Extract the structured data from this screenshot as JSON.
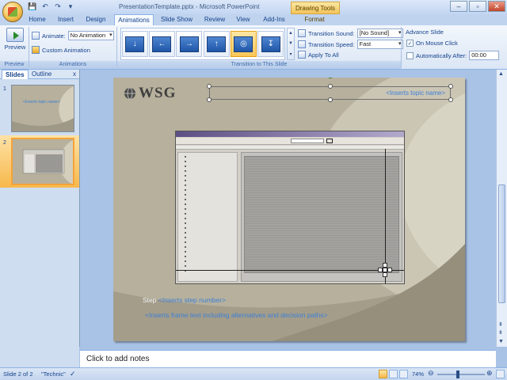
{
  "window": {
    "title": "PresentationTemplate.pptx - Microsoft PowerPoint",
    "contextual_tab": "Drawing Tools",
    "controls": [
      "–",
      "▫",
      "✕"
    ]
  },
  "quick_access": [
    "save-icon",
    "undo-icon",
    "redo-icon",
    "customize-icon"
  ],
  "tabs": [
    "Home",
    "Insert",
    "Design",
    "Animations",
    "Slide Show",
    "Review",
    "View",
    "Add-Ins",
    "Format"
  ],
  "active_tab": "Animations",
  "ribbon": {
    "preview_group": {
      "button": "Preview",
      "label": "Preview"
    },
    "animations_group": {
      "animate_label": "Animate:",
      "animate_value": "No Animation",
      "custom_animation": "Custom Animation",
      "label": "Animations"
    },
    "transition_group": {
      "transition_sound_label": "Transition Sound:",
      "transition_sound_value": "[No Sound]",
      "transition_speed_label": "Transition Speed:",
      "transition_speed_value": "Fast",
      "apply_to_all": "Apply To All",
      "label": "Transition to This Slide"
    },
    "advance_group": {
      "title": "Advance Slide",
      "on_mouse_click": "On Mouse Click",
      "on_mouse_click_checked": true,
      "automatically_after": "Automatically After:",
      "automatically_after_checked": false,
      "time_value": "00:00"
    }
  },
  "side_panel": {
    "tabs": [
      "Slides",
      "Outline"
    ],
    "close": "x",
    "thumbnails": [
      {
        "number": "1",
        "text": "<Inserts topic name>"
      },
      {
        "number": "2"
      }
    ]
  },
  "slide": {
    "logo_text": "WSG",
    "topic_placeholder": "<Inserts topic name>",
    "step_label": "Step",
    "step_placeholder": "<Inserts step number>",
    "frame_text": "<Inserts frame text including alternatives and decision paths>"
  },
  "notes_placeholder": "Click to add notes",
  "status": {
    "slide_counter": "Slide 2 of 2",
    "theme": "\"Technic\"",
    "zoom": "74%"
  },
  "colors": {
    "ribbon_bg": "#dbe6f5",
    "accent_blue": "#15428b",
    "slide_bg": "#b6b09c",
    "placeholder_text": "#3d7fd8",
    "selected_orange": "#f7b84c"
  }
}
